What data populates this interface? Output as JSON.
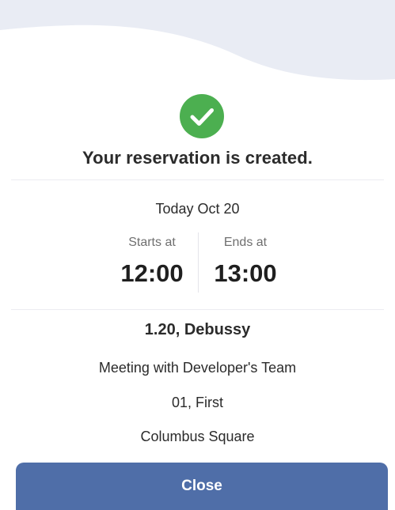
{
  "confirmation": {
    "title": "Your reservation is created.",
    "date": "Today Oct 20",
    "starts_label": "Starts at",
    "starts_value": "12:00",
    "ends_label": "Ends at",
    "ends_value": "13:00",
    "room": "1.20, Debussy",
    "subject": "Meeting with Developer's Team",
    "floor": "01, First",
    "building": "Columbus Square"
  },
  "actions": {
    "close_label": "Close"
  },
  "icons": {
    "success": "check-circle-icon"
  },
  "colors": {
    "success_green": "#4caf50",
    "button_blue": "#4f6ea8",
    "wave_fill": "#e9ecf4"
  }
}
